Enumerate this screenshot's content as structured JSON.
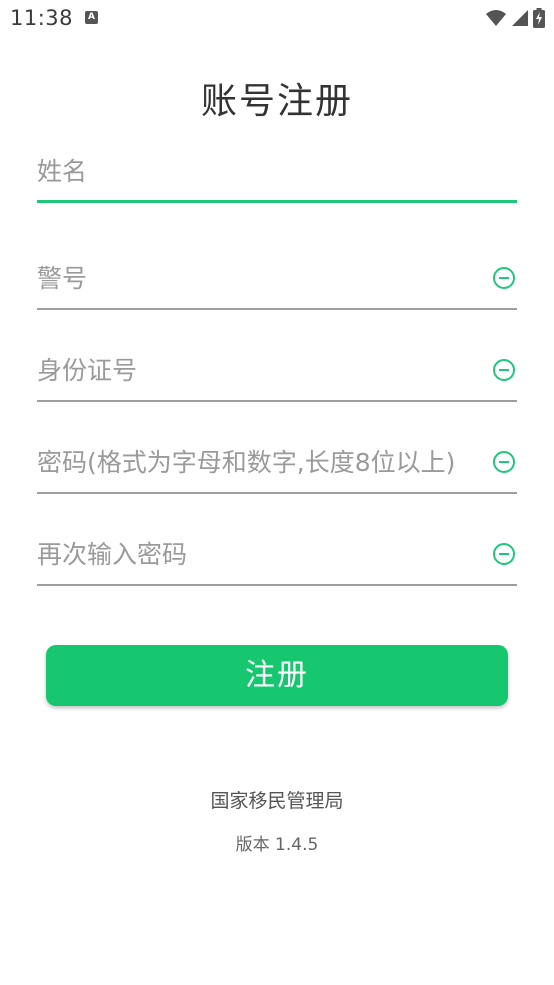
{
  "status_bar": {
    "time": "11:38",
    "notification_icon": "a-icon",
    "icons": [
      "wifi-icon",
      "signal-icon",
      "battery-charging-icon"
    ]
  },
  "page": {
    "title": "账号注册"
  },
  "form": {
    "fields": [
      {
        "placeholder": "姓名",
        "value": "",
        "active": true,
        "clear_icon": false
      },
      {
        "placeholder": "警号",
        "value": "",
        "active": false,
        "clear_icon": true
      },
      {
        "placeholder": "身份证号",
        "value": "",
        "active": false,
        "clear_icon": true
      },
      {
        "placeholder": "密码(格式为字母和数字,长度8位以上)",
        "value": "",
        "active": false,
        "clear_icon": true
      },
      {
        "placeholder": "再次输入密码",
        "value": "",
        "active": false,
        "clear_icon": true
      }
    ],
    "submit_label": "注册"
  },
  "footer": {
    "organization": "国家移民管理局",
    "version": "版本 1.4.5"
  },
  "colors": {
    "accent": "#17c770",
    "active_underline": "#1ec77a",
    "underline": "#9e9e9e",
    "placeholder": "#9a9a9a",
    "title": "#333333"
  }
}
